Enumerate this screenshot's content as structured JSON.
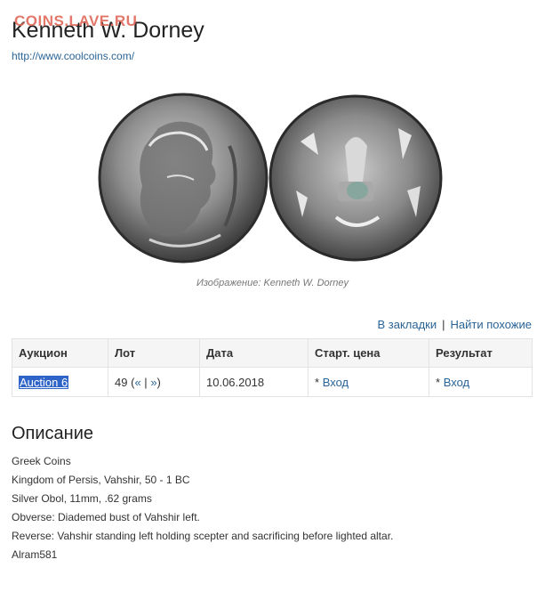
{
  "watermark": "COINS.LAVE.RU",
  "header": {
    "title": "Kenneth W. Dorney",
    "url": "http://www.coolcoins.com/"
  },
  "image": {
    "caption": "Изображение: Kenneth W. Dorney"
  },
  "actions": {
    "bookmark": "В закладки",
    "separator": "|",
    "similar": "Найти похожие"
  },
  "table": {
    "headers": [
      "Аукцион",
      "Лот",
      "Дата",
      "Старт. цена",
      "Результат"
    ],
    "row": {
      "auction": "Auction 6",
      "lot_number": "49",
      "lot_paren_open": "(",
      "lot_prev": "«",
      "lot_sep": "|",
      "lot_next": "»",
      "lot_paren_close": ")",
      "date": "10.06.2018",
      "start_star": "*",
      "start_link": "Вход",
      "result_star": "*",
      "result_link": "Вход"
    }
  },
  "description": {
    "heading": "Описание",
    "lines": [
      "Greek Coins",
      "Kingdom of Persis, Vahshir, 50 - 1 BC",
      "Silver Obol, 11mm, .62 grams",
      "Obverse: Diademed bust of Vahshir left.",
      "Reverse: Vahshir standing left holding scepter and sacrificing before lighted altar.",
      "Alram581"
    ]
  }
}
